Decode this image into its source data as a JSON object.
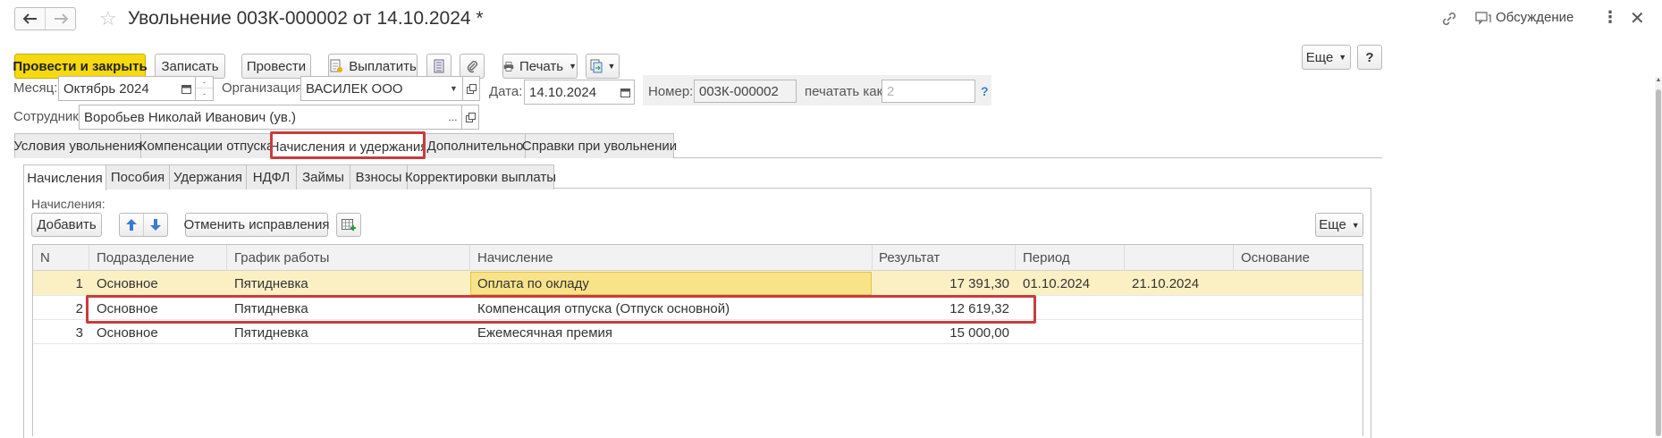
{
  "header": {
    "title": "Увольнение 003К-000002 от 14.10.2024 *",
    "discuss_label": "Обсуждение"
  },
  "toolbar": {
    "post_close": "Провести и закрыть",
    "save": "Записать",
    "post": "Провести",
    "pay": "Выплатить",
    "print": "Печать",
    "more": "Еще",
    "help": "?"
  },
  "form": {
    "month_label": "Месяц:",
    "month_value": "Октябрь 2024",
    "org_label": "Организация:",
    "org_value": "ВАСИЛЕК ООО",
    "date_label": "Дата:",
    "date_value": "14.10.2024",
    "number_label": "Номер:",
    "number_value": "003К-000002",
    "print_as_label": "печатать как:",
    "print_as_placeholder": "2",
    "help_q": "?",
    "employee_label": "Сотрудник:",
    "employee_value": "Воробьев Николай Иванович (ув.)"
  },
  "tabs": [
    {
      "label": "Условия увольнения"
    },
    {
      "label": "Компенсации отпуска"
    },
    {
      "label": "Начисления и удержания"
    },
    {
      "label": "Дополнительно"
    },
    {
      "label": "Справки при увольнении"
    }
  ],
  "subtabs": [
    {
      "label": "Начисления"
    },
    {
      "label": "Пособия"
    },
    {
      "label": "Удержания"
    },
    {
      "label": "НДФЛ"
    },
    {
      "label": "Займы"
    },
    {
      "label": "Взносы"
    },
    {
      "label": "Корректировки выплаты"
    }
  ],
  "accruals": {
    "section_label": "Начисления:",
    "add_label": "Добавить",
    "cancel_fix_label": "Отменить исправления",
    "more_label": "Еще",
    "columns": [
      "N",
      "Подразделение",
      "График работы",
      "Начисление",
      "Результат",
      "Период",
      "",
      "Основание"
    ],
    "rows": [
      {
        "n": "1",
        "dept": "Основное",
        "schedule": "Пятидневка",
        "accrual": "Оплата по окладу",
        "result": "17 391,30",
        "from": "01.10.2024",
        "to": "21.10.2024",
        "basis": ""
      },
      {
        "n": "2",
        "dept": "Основное",
        "schedule": "Пятидневка",
        "accrual": "Компенсация отпуска (Отпуск основной)",
        "result": "12 619,32",
        "from": "",
        "to": "",
        "basis": ""
      },
      {
        "n": "3",
        "dept": "Основное",
        "schedule": "Пятидневка",
        "accrual": "Ежемесячная премия",
        "result": "15 000,00",
        "from": "",
        "to": "",
        "basis": ""
      }
    ]
  },
  "colors": {
    "accent_yellow": "#f6d90f",
    "highlight_red": "#c73d3d",
    "selected_row": "#fbf0c4",
    "selected_cell": "#f9e389"
  }
}
